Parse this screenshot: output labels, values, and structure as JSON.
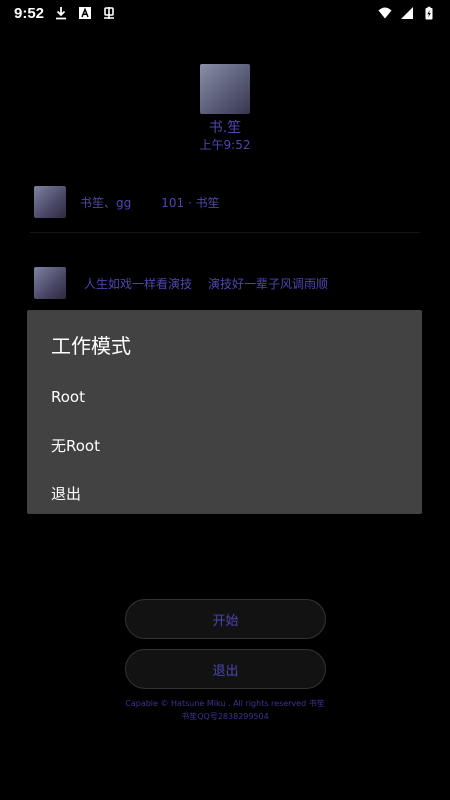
{
  "status_bar": {
    "time": "9:52"
  },
  "profile": {
    "name": "书.笙",
    "time": "上午9:52"
  },
  "messages": [
    {
      "author": "书笙、gg",
      "text": "101 · 书笙"
    },
    {
      "author": "人生如戏一样看演技",
      "text": "演技好一辈子风调雨顺"
    }
  ],
  "dialog": {
    "title": "工作模式",
    "options": [
      "Root",
      "无Root",
      "退出"
    ]
  },
  "buttons": {
    "start": "开始",
    "exit": "退出"
  },
  "footer": {
    "line1": "Capable © Hatsune Miku . All rights reserved 书笙",
    "line2": "书笙QQ号2838299504"
  }
}
